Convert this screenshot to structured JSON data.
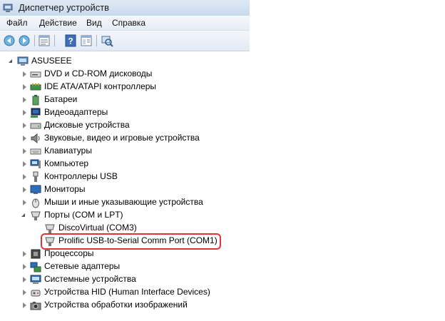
{
  "window": {
    "title": "Диспетчер устройств"
  },
  "menu": [
    "Файл",
    "Действие",
    "Вид",
    "Справка"
  ],
  "toolbar_icons": [
    "back-arrow-icon",
    "forward-arrow-icon",
    "properties-icon",
    "help-icon",
    "properties-panel-icon",
    "scan-hardware-icon"
  ],
  "tree": {
    "root": "ASUSEEE",
    "categories": [
      "DVD и CD-ROM дисководы",
      "IDE ATA/ATAPI контроллеры",
      "Батареи",
      "Видеоадаптеры",
      "Дисковые устройства",
      "Звуковые, видео и игровые устройства",
      "Клавиатуры",
      "Компьютер",
      "Контроллеры USB",
      "Мониторы",
      "Мыши и иные указывающие устройства",
      "Порты (COM и LPT)",
      "Процессоры",
      "Сетевые адаптеры",
      "Системные устройства",
      "Устройства HID (Human Interface Devices)",
      "Устройства обработки изображений"
    ],
    "ports_children": [
      "DiscoVirtual (COM3)",
      "Prolific USB-to-Serial Comm Port (COM1)"
    ]
  },
  "colors": {
    "highlight": "#e0343a",
    "titlebar": "#c9daee"
  }
}
